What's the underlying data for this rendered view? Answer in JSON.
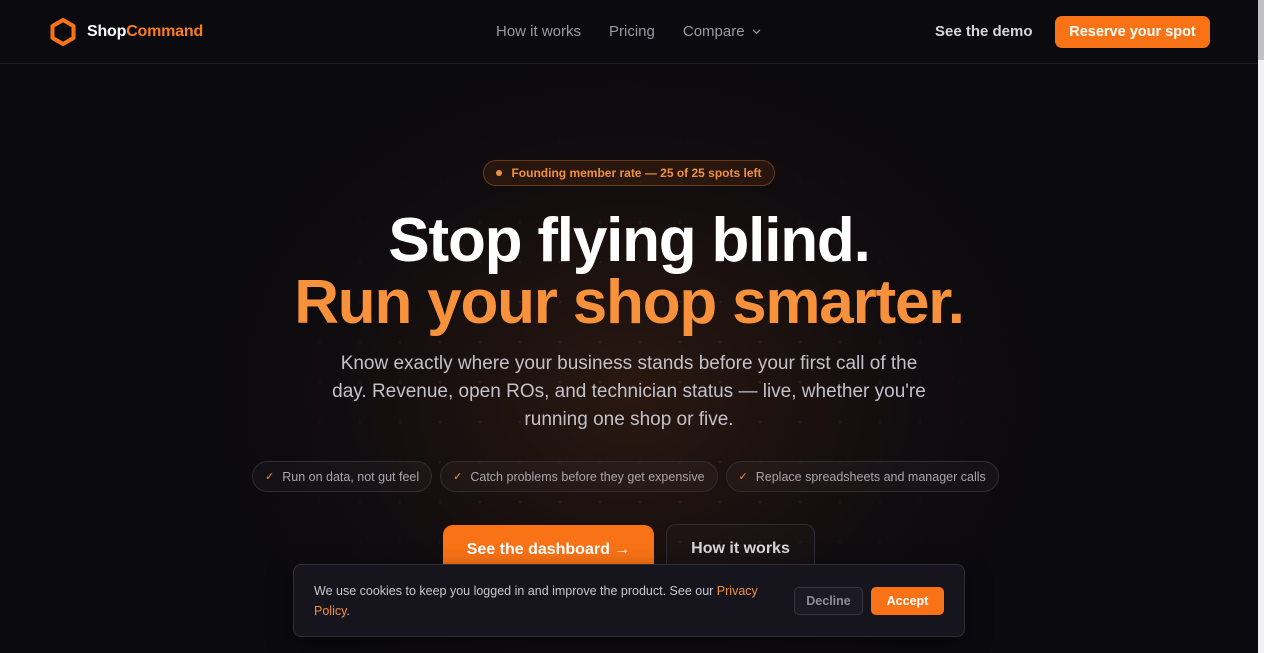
{
  "nav": {
    "brand_part1": "Shop",
    "brand_part2": "Command",
    "links": [
      "How it works",
      "Pricing",
      "Compare"
    ],
    "demo_label": "See the demo",
    "reserve_label": "Reserve your spot"
  },
  "hero": {
    "badge": "Founding member rate — 25 of 25 spots left",
    "headline_line1": "Stop flying blind.",
    "headline_line2": "Run your shop smarter.",
    "subtitle": "Know exactly where your business stands before your first call of the day. Revenue, open ROs, and technician status — live, whether you're running one shop or five.",
    "pills": [
      "Run on data, not gut feel",
      "Catch problems before they get expensive",
      "Replace spreadsheets and manager calls"
    ],
    "cta_primary": "See the dashboard →",
    "cta_secondary": "How it works"
  },
  "cookie": {
    "text_before_link": "We use cookies to keep you logged in and improve the product. See our ",
    "link_label": "Privacy Policy",
    "text_after_link": ".",
    "decline_label": "Decline",
    "accept_label": "Accept"
  },
  "colors": {
    "accent": "#f97316",
    "accent_text": "#f7913b",
    "background": "#0b0a0f"
  },
  "icons": {
    "logo": "hexagon-logo-icon",
    "compare_dropdown": "chevron-down-icon",
    "pill_check": "check-icon",
    "badge_dot": "dot-icon"
  }
}
